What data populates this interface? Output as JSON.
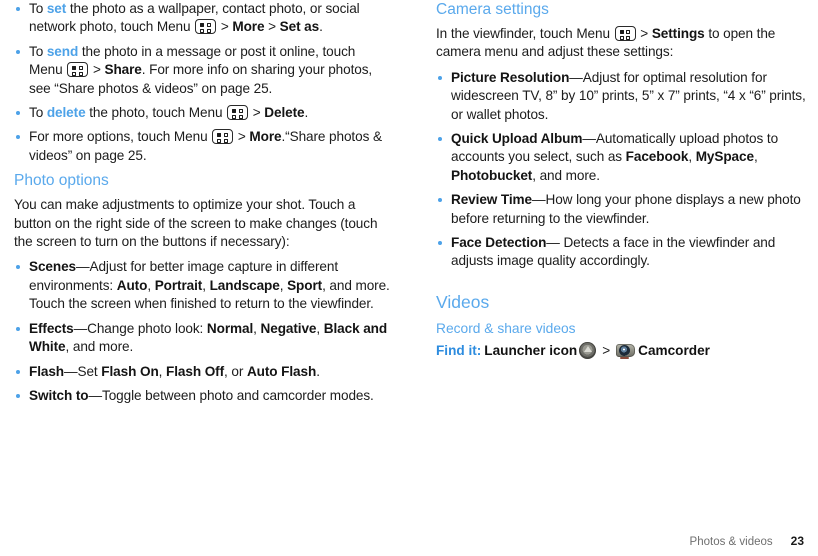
{
  "document": {
    "footer": {
      "chapter": "Photos & videos",
      "page_number": "23"
    }
  },
  "left_column": {
    "photo_bullets": [
      {
        "id": "set-photo",
        "seg": [
          {
            "t": "To ",
            "s": "n"
          },
          {
            "t": "set",
            "s": "lb"
          },
          {
            "t": " the photo as a wallpaper, contact photo, or social network photo, touch Menu ",
            "s": "n"
          },
          {
            "t": "MENU_ICON",
            "s": "icon"
          },
          {
            "t": " > ",
            "s": "n"
          },
          {
            "t": "More",
            "s": "b"
          },
          {
            "t": " > ",
            "s": "n"
          },
          {
            "t": "Set as",
            "s": "b"
          },
          {
            "t": ".",
            "s": "n"
          }
        ]
      },
      {
        "id": "send-photo",
        "seg": [
          {
            "t": "To ",
            "s": "n"
          },
          {
            "t": "send",
            "s": "lb"
          },
          {
            "t": " the photo in a message or post it online, touch Menu ",
            "s": "n"
          },
          {
            "t": "MENU_ICON",
            "s": "icon"
          },
          {
            "t": " > ",
            "s": "n"
          },
          {
            "t": "Share",
            "s": "b"
          },
          {
            "t": ". For more info on sharing your photos, see “Share photos & videos” on page 25.",
            "s": "n"
          }
        ]
      },
      {
        "id": "delete-photo",
        "seg": [
          {
            "t": "To ",
            "s": "n"
          },
          {
            "t": "delete",
            "s": "lb"
          },
          {
            "t": " the photo, touch Menu ",
            "s": "n"
          },
          {
            "t": "MENU_ICON",
            "s": "icon"
          },
          {
            "t": " > ",
            "s": "n"
          },
          {
            "t": "Delete",
            "s": "b"
          },
          {
            "t": ".",
            "s": "n"
          }
        ]
      },
      {
        "id": "more-options",
        "seg": [
          {
            "t": "For more options, touch Menu ",
            "s": "n"
          },
          {
            "t": "MENU_ICON",
            "s": "icon"
          },
          {
            "t": " > ",
            "s": "n"
          },
          {
            "t": "More",
            "s": "b"
          },
          {
            "t": ".“Share photos & videos” on page 25.",
            "s": "n"
          }
        ]
      }
    ],
    "photo_options": {
      "heading": "Photo options",
      "intro": "You can make adjustments to optimize your shot. Touch a button on the right side of the screen to make changes (touch the screen to turn on the buttons if necessary):",
      "bullets": [
        {
          "id": "scenes",
          "seg": [
            {
              "t": "Scenes",
              "s": "b"
            },
            {
              "t": "—Adjust for better image capture in different environments: ",
              "s": "n"
            },
            {
              "t": "Auto",
              "s": "b"
            },
            {
              "t": ", ",
              "s": "n"
            },
            {
              "t": "Portrait",
              "s": "b"
            },
            {
              "t": ", ",
              "s": "n"
            },
            {
              "t": "Landscape",
              "s": "b"
            },
            {
              "t": ", ",
              "s": "n"
            },
            {
              "t": "Sport",
              "s": "b"
            },
            {
              "t": ", and more. Touch the screen when finished to return to the viewfinder.",
              "s": "n"
            }
          ]
        },
        {
          "id": "effects",
          "seg": [
            {
              "t": "Effects",
              "s": "b"
            },
            {
              "t": "—Change photo look: ",
              "s": "n"
            },
            {
              "t": "Normal",
              "s": "b"
            },
            {
              "t": ", ",
              "s": "n"
            },
            {
              "t": "Negative",
              "s": "b"
            },
            {
              "t": ", ",
              "s": "n"
            },
            {
              "t": "Black and White",
              "s": "b"
            },
            {
              "t": ", and more.",
              "s": "n"
            }
          ]
        },
        {
          "id": "flash",
          "seg": [
            {
              "t": "Flash",
              "s": "b"
            },
            {
              "t": "—Set ",
              "s": "n"
            },
            {
              "t": "Flash On",
              "s": "b"
            },
            {
              "t": ", ",
              "s": "n"
            },
            {
              "t": "Flash Off",
              "s": "b"
            },
            {
              "t": ", or ",
              "s": "n"
            },
            {
              "t": "Auto Flash",
              "s": "b"
            },
            {
              "t": ".",
              "s": "n"
            }
          ]
        },
        {
          "id": "switch-to",
          "seg": [
            {
              "t": "Switch to",
              "s": "b"
            },
            {
              "t": "—Toggle between photo and camcorder modes.",
              "s": "n"
            }
          ]
        }
      ]
    }
  },
  "right_column": {
    "camera_settings": {
      "heading": "Camera settings",
      "intro_seg": [
        {
          "t": "In the viewfinder, touch Menu ",
          "s": "n"
        },
        {
          "t": "MENU_ICON",
          "s": "icon"
        },
        {
          "t": " > ",
          "s": "n"
        },
        {
          "t": "Settings",
          "s": "b"
        },
        {
          "t": " to open the camera menu and adjust these settings:",
          "s": "n"
        }
      ],
      "bullets": [
        {
          "id": "picture-resolution",
          "seg": [
            {
              "t": "Picture Resolution",
              "s": "b"
            },
            {
              "t": "—Adjust for optimal resolution for widescreen TV, 8” by 10” prints, 5” x 7” prints, “4 x “6” prints, or wallet photos.",
              "s": "n"
            }
          ]
        },
        {
          "id": "quick-upload-album",
          "seg": [
            {
              "t": "Quick Upload Album",
              "s": "b"
            },
            {
              "t": "—Automatically upload photos to accounts you select, such as ",
              "s": "n"
            },
            {
              "t": "Facebook",
              "s": "b"
            },
            {
              "t": ", ",
              "s": "n"
            },
            {
              "t": "MySpace",
              "s": "b"
            },
            {
              "t": ", ",
              "s": "n"
            },
            {
              "t": "Photobucket",
              "s": "b"
            },
            {
              "t": ", and more.",
              "s": "n"
            }
          ]
        },
        {
          "id": "review-time",
          "seg": [
            {
              "t": " Review Time",
              "s": "b"
            },
            {
              "t": "—How long your phone displays a new photo before returning to the viewfinder.",
              "s": "n"
            }
          ]
        },
        {
          "id": "face-detection",
          "seg": [
            {
              "t": " Face Detection",
              "s": "b"
            },
            {
              "t": "— Detects a face in the viewfinder and adjusts image quality accordingly.",
              "s": "n"
            }
          ]
        }
      ]
    },
    "videos": {
      "heading": "Videos",
      "subheading": "Record & share videos",
      "find_it": {
        "label": "Find it:",
        "step1": "Launcher icon",
        "separator": ">",
        "step2": "Camcorder"
      }
    }
  },
  "colors": {
    "heading_blue": "#5aa9ec",
    "link_blue": "#4da2e8",
    "findit_blue": "#2d8cdf",
    "body_text": "#1c1c1c",
    "footer_text": "#6f6f6f"
  },
  "icons": {
    "menu_key": "menu-key-icon",
    "launcher": "launcher-icon",
    "camcorder": "camcorder-icon"
  }
}
